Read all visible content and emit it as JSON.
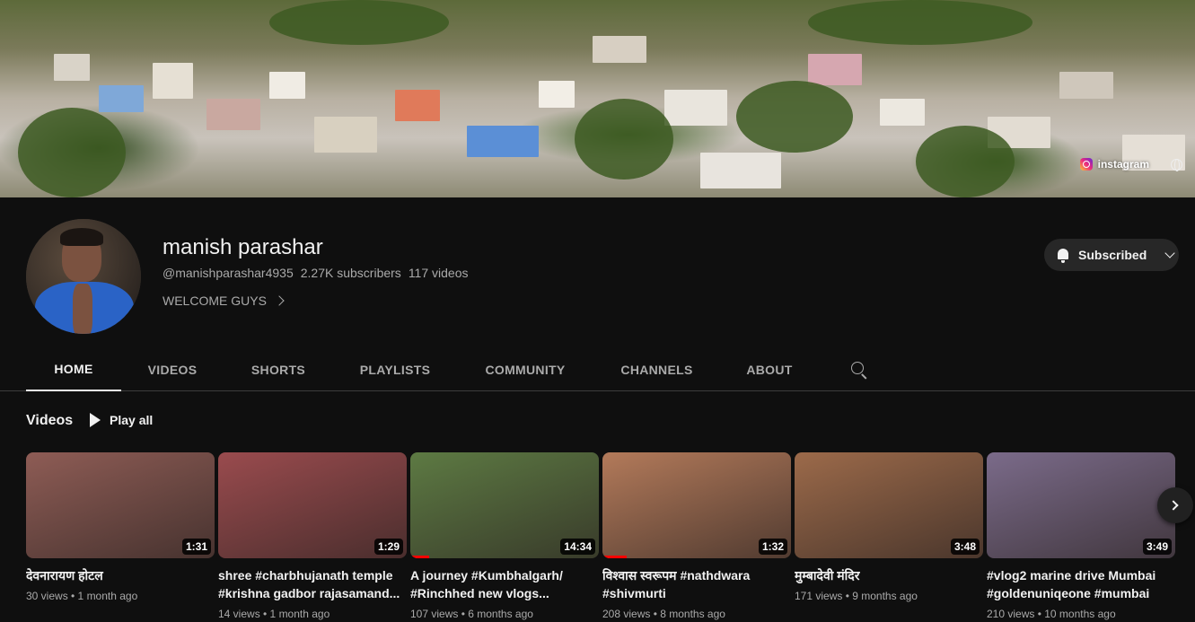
{
  "banner": {
    "links": [
      {
        "label": "instagram",
        "icon": "instagram-icon"
      },
      {
        "label": "",
        "icon": "globe-icon"
      }
    ]
  },
  "channel": {
    "name": "manish parashar",
    "handle": "@manishparashar4935",
    "subscribers": "2.27K subscribers",
    "videos": "117 videos",
    "description": "WELCOME GUYS",
    "subscribe_label": "Subscribed"
  },
  "tabs": [
    "HOME",
    "VIDEOS",
    "SHORTS",
    "PLAYLISTS",
    "COMMUNITY",
    "CHANNELS",
    "ABOUT"
  ],
  "active_tab": "HOME",
  "section": {
    "title": "Videos",
    "play_all": "Play all"
  },
  "videos": [
    {
      "title": "देवनारायण होटल",
      "duration": "1:31",
      "meta": "30 views • 1 month ago",
      "thumb_color": "#8e5c55",
      "watched": 0
    },
    {
      "title": "shree #charbhujanath temple #krishna gadbor rajasamand...",
      "duration": "1:29",
      "meta": "14 views • 1 month ago",
      "thumb_color": "#9a4b4e",
      "watched": 0
    },
    {
      "title": "A journey #Kumbhalgarh/ #Rinchhed new vlogs...",
      "duration": "14:34",
      "meta": "107 views • 6 months ago",
      "thumb_color": "#5d7a43",
      "watched": 0.1
    },
    {
      "title": "विश्वास स्वरूपम #nathdwara #shivmurti",
      "duration": "1:32",
      "meta": "208 views • 8 months ago",
      "thumb_color": "#b37a5a",
      "watched": 0.13
    },
    {
      "title": "मुम्बादेवी मंदिर",
      "duration": "3:48",
      "meta": "171 views • 9 months ago",
      "thumb_color": "#9c6a4a",
      "watched": 0
    },
    {
      "title": "#vlog2 marine drive Mumbai #goldenuniqeone #mumbai",
      "duration": "3:49",
      "meta": "210 views • 10 months ago",
      "thumb_color": "#7b6b8a",
      "watched": 0
    }
  ]
}
